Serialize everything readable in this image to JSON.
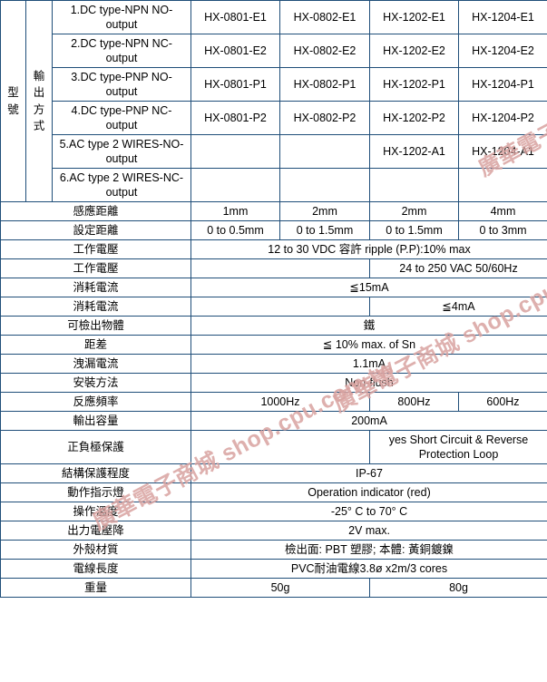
{
  "table": {
    "row_group_labels": {
      "model": "型號",
      "output_method": "輸出方式"
    },
    "output_types": [
      "1.DC type-NPN NO-output",
      "2.DC type-NPN NC-output",
      "3.DC type-PNP NO-output",
      "4.DC type-PNP NC-output",
      "5.AC type 2 WIRES-NO-output",
      "6.AC type 2 WIRES-NC-output"
    ],
    "model_rows": [
      {
        "c1": "HX-0801-E1",
        "c2": "HX-0802-E1",
        "c3": "HX-1202-E1",
        "c4": "HX-1204-E1"
      },
      {
        "c1": "HX-0801-E2",
        "c2": "HX-0802-E2",
        "c3": "HX-1202-E2",
        "c4": "HX-1204-E2"
      },
      {
        "c1": "HX-0801-P1",
        "c2": "HX-0802-P1",
        "c3": "HX-1202-P1",
        "c4": "HX-1204-P1"
      },
      {
        "c1": "HX-0801-P2",
        "c2": "HX-0802-P2",
        "c3": "HX-1202-P2",
        "c4": "HX-1204-P2"
      },
      {
        "c1": "",
        "c2": "",
        "c3": "HX-1202-A1",
        "c4": "HX-1204-A1"
      },
      {
        "c1": "",
        "c2": "",
        "c3": "",
        "c4": ""
      }
    ],
    "spec_rows": [
      {
        "label": "感應距離",
        "cells": [
          {
            "text": "1mm",
            "span": 1
          },
          {
            "text": "2mm",
            "span": 1
          },
          {
            "text": "2mm",
            "span": 1
          },
          {
            "text": "4mm",
            "span": 1
          }
        ]
      },
      {
        "label": "設定距離",
        "cells": [
          {
            "text": "0 to 0.5mm",
            "span": 1
          },
          {
            "text": "0 to 1.5mm",
            "span": 1
          },
          {
            "text": "0 to 1.5mm",
            "span": 1
          },
          {
            "text": "0 to 3mm",
            "span": 1
          }
        ]
      },
      {
        "label": "工作電壓",
        "cells": [
          {
            "text": "12 to 30 VDC 容許 ripple (P.P):10% max",
            "span": 4
          }
        ]
      },
      {
        "label": "工作電壓",
        "cells": [
          {
            "text": "",
            "span": 2
          },
          {
            "text": "24 to 250 VAC 50/60Hz",
            "span": 2
          }
        ]
      },
      {
        "label": "消耗電流",
        "cells": [
          {
            "text": "≦15mA",
            "span": 4
          }
        ]
      },
      {
        "label": "消耗電流",
        "cells": [
          {
            "text": "",
            "span": 2
          },
          {
            "text": "≦4mA",
            "span": 2
          }
        ]
      },
      {
        "label": "可檢出物體",
        "cells": [
          {
            "text": "鐵",
            "span": 4
          }
        ]
      },
      {
        "label": "距差",
        "cells": [
          {
            "text": "≦ 10% max. of Sn",
            "span": 4
          }
        ]
      },
      {
        "label": "洩漏電流",
        "cells": [
          {
            "text": "1.1mA",
            "span": 4
          }
        ]
      },
      {
        "label": "安裝方法",
        "cells": [
          {
            "text": "Non-flush",
            "span": 4
          }
        ]
      },
      {
        "label": "反應頻率",
        "cells": [
          {
            "text": "1000Hz",
            "span": 2
          },
          {
            "text": "800Hz",
            "span": 1
          },
          {
            "text": "600Hz",
            "span": 1
          }
        ]
      },
      {
        "label": "輸出容量",
        "cells": [
          {
            "text": "200mA",
            "span": 4
          }
        ]
      },
      {
        "label": "正負極保護",
        "cells": [
          {
            "text": "",
            "span": 2
          },
          {
            "text": "yes Short Circuit & Reverse Protection Loop",
            "span": 2
          }
        ]
      },
      {
        "label": "結構保護程度",
        "cells": [
          {
            "text": "IP-67",
            "span": 4
          }
        ]
      },
      {
        "label": "動作指示燈",
        "cells": [
          {
            "text": "Operation indicator (red)",
            "span": 4
          }
        ]
      },
      {
        "label": "操作溫度",
        "cells": [
          {
            "text": "-25° C to 70° C",
            "span": 4
          }
        ]
      },
      {
        "label": "出力電壓降",
        "cells": [
          {
            "text": "2V max.",
            "span": 4
          }
        ]
      },
      {
        "label": "外殼材質",
        "cells": [
          {
            "text": "檢出面: PBT 塑膠; 本體: 黃銅鍍鎳",
            "span": 4
          }
        ]
      },
      {
        "label": "電線長度",
        "cells": [
          {
            "text": "PVC耐油電線3.8ø x2m/3 cores",
            "span": 4
          }
        ]
      },
      {
        "label": "重量",
        "cells": [
          {
            "text": "50g",
            "span": 2
          },
          {
            "text": "80g",
            "span": 2
          }
        ]
      }
    ]
  },
  "watermark": {
    "text": "廣華電子商城 shop.cpu.com.tw",
    "color": "#d9a3a0"
  },
  "colors": {
    "header_fill": "#b9d5f0",
    "border": "#1f4e79",
    "body_fill": "#ffffff"
  }
}
